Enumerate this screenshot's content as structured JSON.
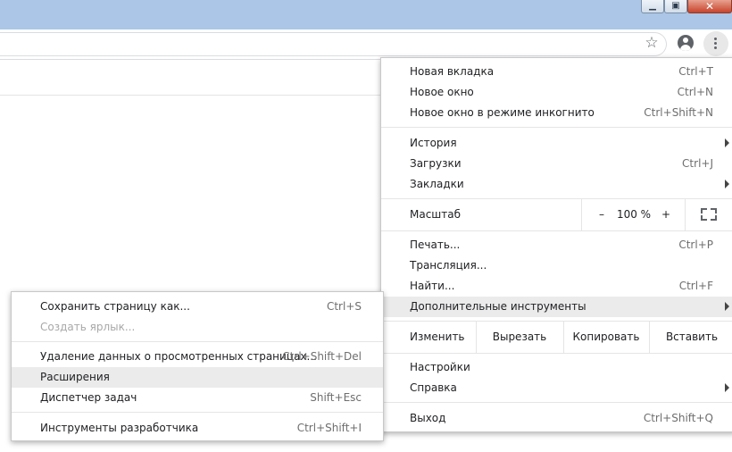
{
  "window": {
    "minimize_glyph": "▁",
    "maximize_glyph": "▣",
    "close_glyph": "✕"
  },
  "toolbar": {
    "bookmark_icon": "star-icon",
    "star_glyph": "☆"
  },
  "main_menu": {
    "new_tab": {
      "label": "Новая вкладка",
      "shortcut": "Ctrl+T"
    },
    "new_window": {
      "label": "Новое окно",
      "shortcut": "Ctrl+N"
    },
    "incognito": {
      "label": "Новое окно в режиме инкогнито",
      "shortcut": "Ctrl+Shift+N"
    },
    "history": {
      "label": "История"
    },
    "downloads": {
      "label": "Загрузки",
      "shortcut": "Ctrl+J"
    },
    "bookmarks": {
      "label": "Закладки"
    },
    "zoom": {
      "label": "Масштаб",
      "minus": "–",
      "value": "100 %",
      "plus": "+"
    },
    "print": {
      "label": "Печать...",
      "shortcut": "Ctrl+P"
    },
    "cast": {
      "label": "Трансляция..."
    },
    "find": {
      "label": "Найти...",
      "shortcut": "Ctrl+F"
    },
    "more_tools": {
      "label": "Дополнительные инструменты"
    },
    "edit": {
      "label": "Изменить",
      "cut": "Вырезать",
      "copy": "Копировать",
      "paste": "Вставить"
    },
    "settings": {
      "label": "Настройки"
    },
    "help": {
      "label": "Справка"
    },
    "exit": {
      "label": "Выход",
      "shortcut": "Ctrl+Shift+Q"
    }
  },
  "sub_menu": {
    "save_page": {
      "label": "Сохранить страницу как...",
      "shortcut": "Ctrl+S"
    },
    "create_shortcut": {
      "label": "Создать ярлык..."
    },
    "clear_data": {
      "label": "Удаление данных о просмотренных страницах...",
      "shortcut": "Ctrl+Shift+Del"
    },
    "extensions": {
      "label": "Расширения"
    },
    "task_manager": {
      "label": "Диспетчер задач",
      "shortcut": "Shift+Esc"
    },
    "dev_tools": {
      "label": "Инструменты разработчика",
      "shortcut": "Ctrl+Shift+I"
    }
  }
}
